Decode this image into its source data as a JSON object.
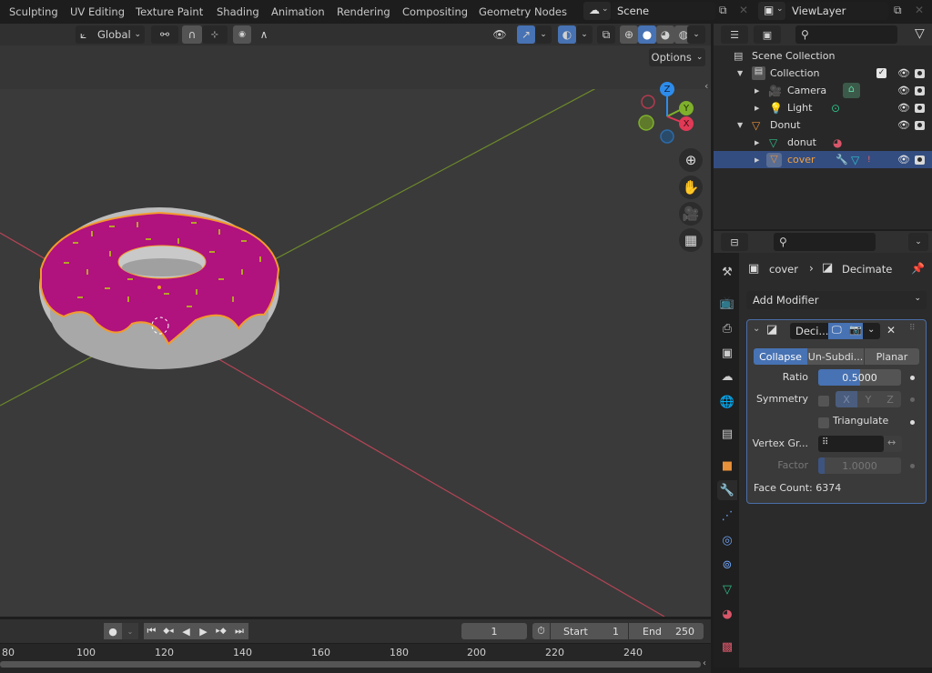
{
  "workspaces": [
    "Sculpting",
    "UV Editing",
    "Texture Paint",
    "Shading",
    "Animation",
    "Rendering",
    "Compositing",
    "Geometry Nodes"
  ],
  "scene": {
    "label": "Scene",
    "view_layer": "ViewLayer"
  },
  "viewport": {
    "transform_orientation": "Global",
    "options_label": "Options",
    "gizmo": {
      "z": "Z",
      "y": "Y",
      "x": "X"
    },
    "colors": {
      "x_axis": "#c04656",
      "y_axis": "#7a9a2c",
      "selection_outline": "#f29a2e",
      "icing": "#b0127e"
    }
  },
  "timeline": {
    "current_frame": "1",
    "start_label": "Start",
    "start": "1",
    "end_label": "End",
    "end": "250",
    "ruler_ticks": [
      "80",
      "100",
      "120",
      "140",
      "160",
      "180",
      "200",
      "220",
      "240"
    ]
  },
  "outliner": {
    "search_placeholder": "",
    "items": [
      {
        "label": "Scene Collection",
        "depth": 0
      },
      {
        "label": "Collection",
        "depth": 1
      },
      {
        "label": "Camera",
        "depth": 2
      },
      {
        "label": "Light",
        "depth": 2
      },
      {
        "label": "Donut",
        "depth": 1
      },
      {
        "label": "donut",
        "depth": 2
      },
      {
        "label": "cover",
        "depth": 2,
        "selected": true
      }
    ]
  },
  "properties": {
    "breadcrumb": {
      "object": "cover",
      "modifier": "Decimate"
    },
    "add_modifier": "Add Modifier",
    "modifier": {
      "name": "Deci...",
      "modes": [
        "Collapse",
        "Un-Subdi...",
        "Planar"
      ],
      "active_mode": "Collapse",
      "ratio_label": "Ratio",
      "ratio": "0.5000",
      "ratio_fraction": 0.5,
      "symmetry_label": "Symmetry",
      "axes": [
        "X",
        "Y",
        "Z"
      ],
      "triangulate_label": "Triangulate",
      "vertex_group_label": "Vertex Gr...",
      "factor_label": "Factor",
      "factor": "1.0000",
      "face_count": "Face Count: 6374"
    }
  }
}
